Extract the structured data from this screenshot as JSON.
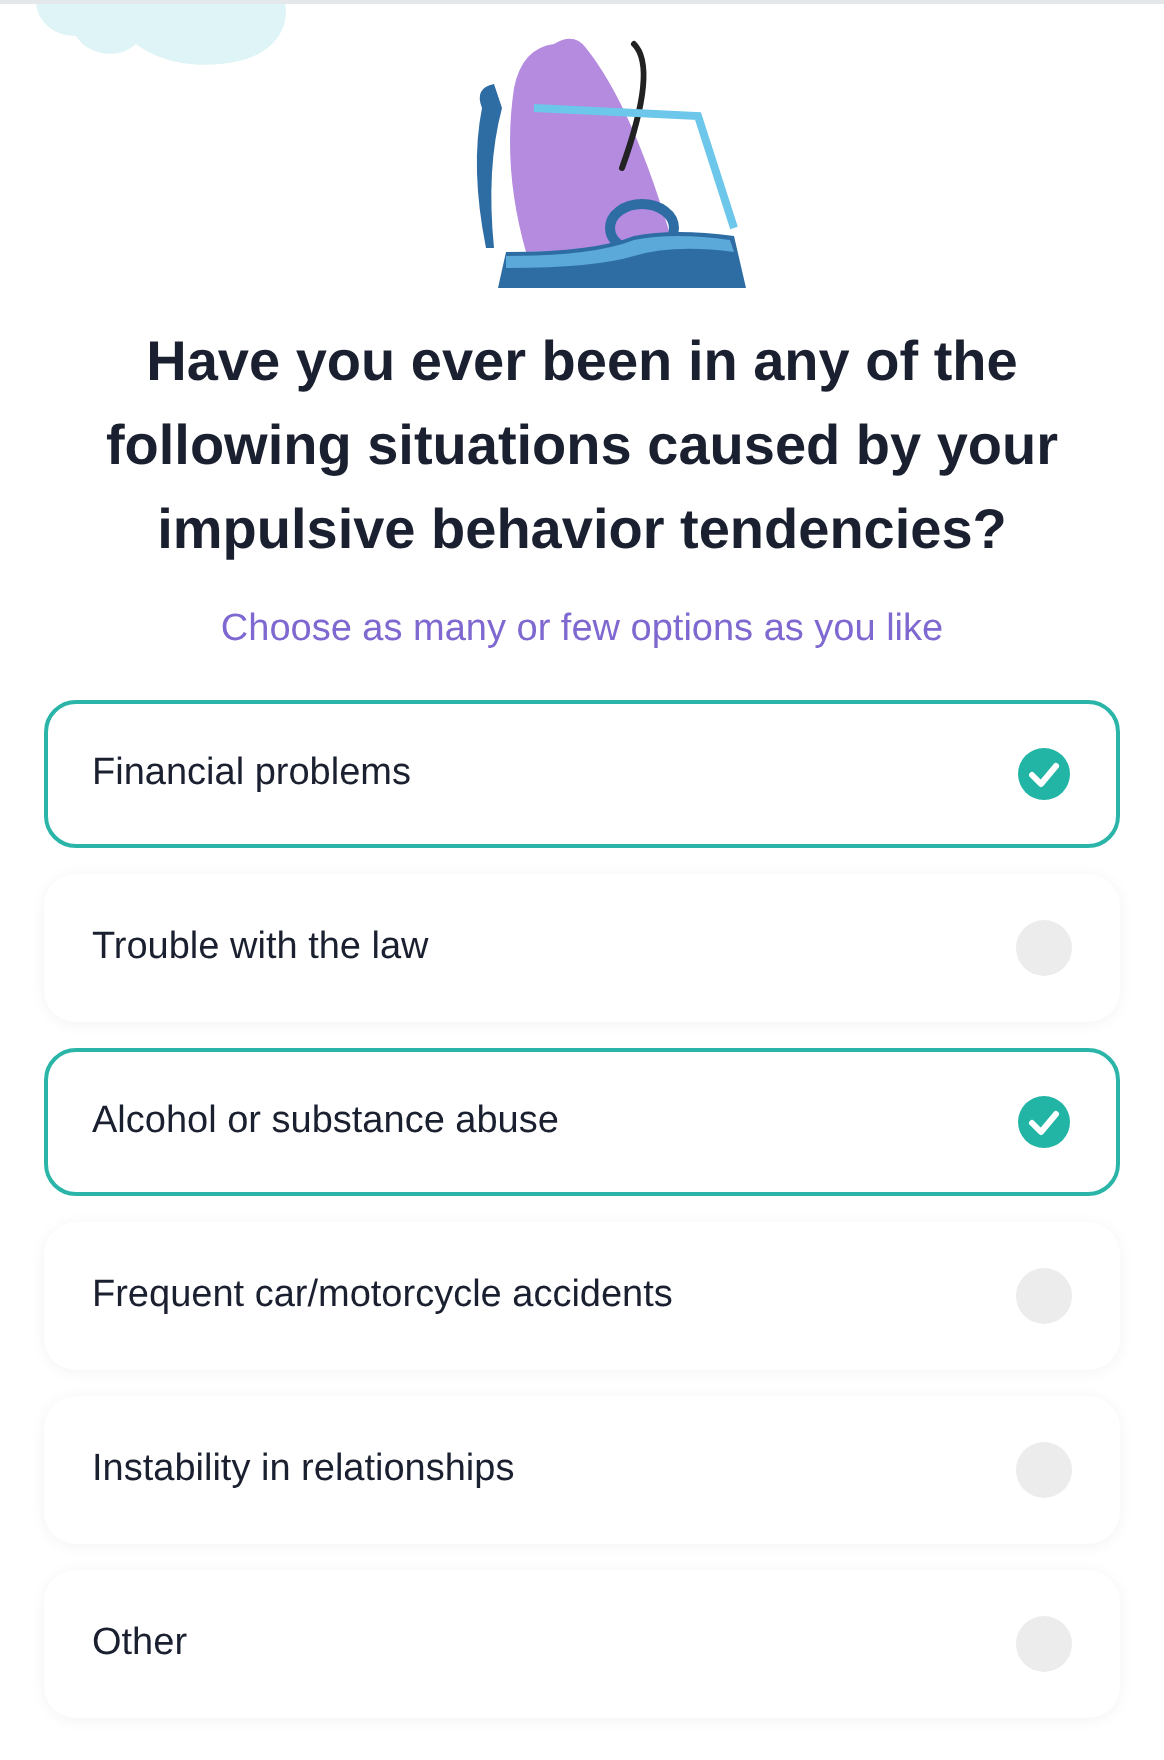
{
  "question": "Have you ever been in any of the following situations caused by your impulsive behavior tendencies?",
  "hint": "Choose as many or few options as you like",
  "options": [
    {
      "label": "Financial problems",
      "selected": true
    },
    {
      "label": "Trouble with the law",
      "selected": false
    },
    {
      "label": "Alcohol or substance abuse",
      "selected": true
    },
    {
      "label": "Frequent car/motorcycle accidents",
      "selected": false
    },
    {
      "label": "Instability in relationships",
      "selected": false
    },
    {
      "label": "Other",
      "selected": false
    }
  ]
}
